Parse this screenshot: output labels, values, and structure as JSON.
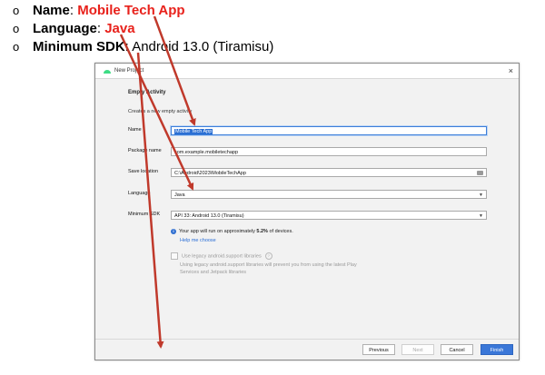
{
  "bullets": [
    {
      "mark": "o",
      "key": "Name",
      "sep": ": ",
      "value": "Mobile Tech App"
    },
    {
      "mark": "o",
      "key": "Language",
      "sep": ": ",
      "value": "Java"
    },
    {
      "mark": "o",
      "key": "Minimum SDK",
      "sep": ": ",
      "value": "Android 13.0 (Tiramisu)"
    }
  ],
  "dialog": {
    "title": "New Project",
    "close_icon": "×",
    "heading": "Empty Activity",
    "subtitle": "Creates a new empty activity",
    "name_label": "Name",
    "name_value": "Mobile Tech App",
    "package_label": "Package name",
    "package_value": "com.example.mobiletechapp",
    "save_label": "Save location",
    "save_value": "C:\\Android\\2023\\MobileTechApp",
    "language_label": "Language",
    "language_value": "Java",
    "minsdk_label": "Minimum SDK",
    "minsdk_value": "API 33: Android 13.0 (Tiramisu)",
    "info_prefix": "Your app will run on approximately ",
    "info_percent": "5.2%",
    "info_suffix": " of devices.",
    "help_link": "Help me choose",
    "legacy_label": "Use legacy android.support libraries",
    "legacy_note": "Using legacy android.support libraries will prevent you from using the latest Play Services and Jetpack libraries",
    "buttons": {
      "previous": "Previous",
      "next": "Next",
      "cancel": "Cancel",
      "finish": "Finish"
    }
  },
  "colors": {
    "highlight_red": "#e8211b",
    "arrow_red": "#c0392b",
    "accent_blue": "#3a77d8",
    "android_green": "#3ddc84"
  }
}
